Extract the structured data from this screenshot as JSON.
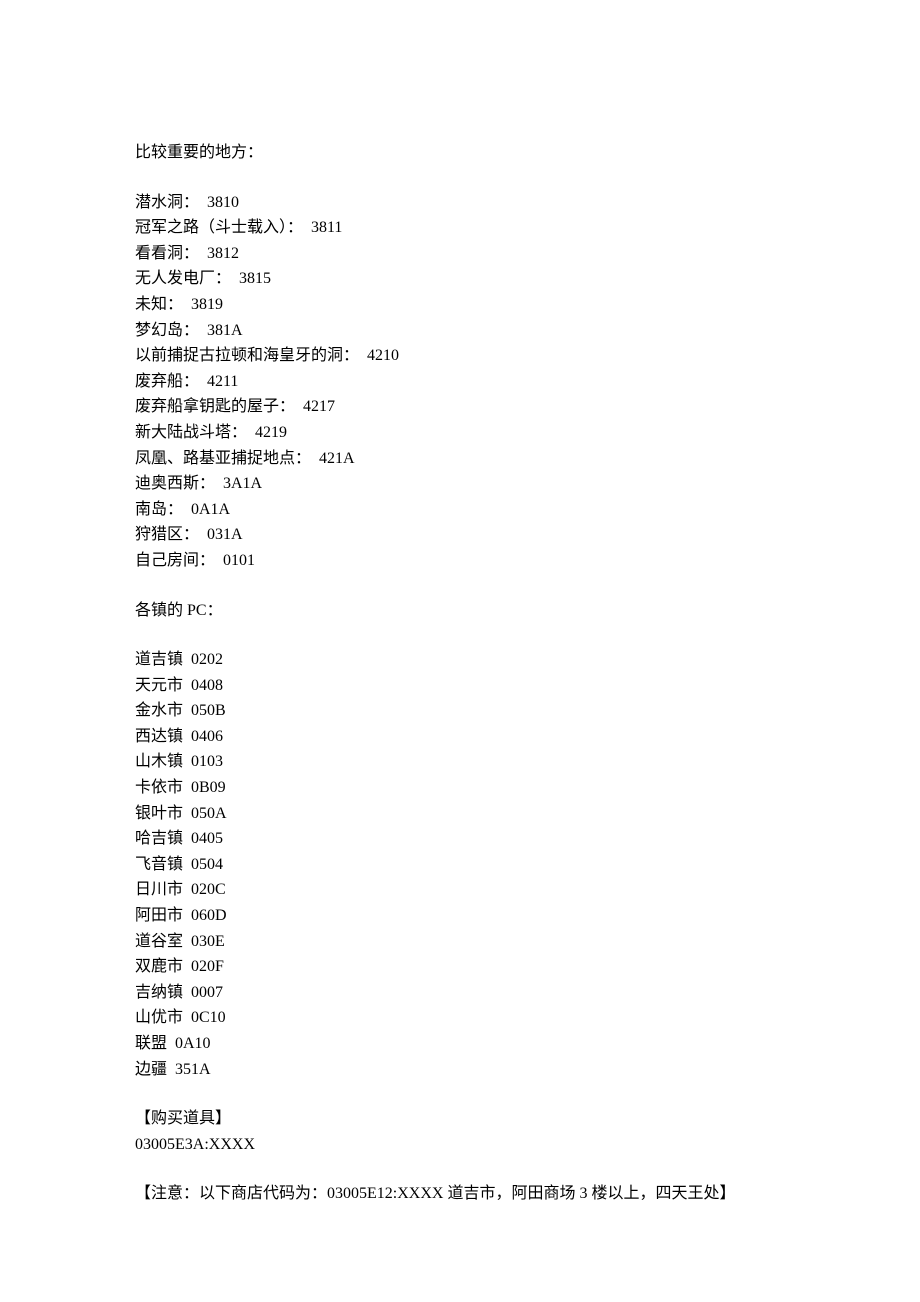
{
  "section1_title": "比较重要的地方：",
  "important_places": [
    "潜水洞：  3810",
    "冠军之路（斗士载入）：  3811",
    "看看洞：  3812",
    "无人发电厂：  3815",
    "未知：  3819",
    "梦幻岛：  381A",
    "以前捕捉古拉顿和海皇牙的洞：  4210",
    "废弃船：  4211",
    "废弃船拿钥匙的屋子：  4217",
    "新大陆战斗塔：  4219",
    "凤凰、路基亚捕捉地点：  421A",
    "迪奥西斯：  3A1A",
    "南岛：  0A1A",
    "狩猎区：  031A",
    "自己房间：  0101"
  ],
  "section2_title": "各镇的 PC：",
  "town_pcs": [
    "道吉镇  0202",
    "天元市  0408",
    "金水市  050B",
    "西达镇  0406",
    "山木镇  0103",
    "卡依市  0B09",
    "银叶市  050A",
    "哈吉镇  0405",
    "飞音镇  0504",
    "日川市  020C",
    "阿田市  060D",
    "道谷室  030E",
    "双鹿市  020F",
    "吉纳镇  0007",
    "山优市  0C10",
    "联盟  0A10",
    "边疆  351A"
  ],
  "buy_item_title": "【购买道具】",
  "buy_item_code": "03005E3A:XXXX",
  "note": "【注意：以下商店代码为：03005E12:XXXX 道吉市，阿田商场 3 楼以上，四天王处】"
}
